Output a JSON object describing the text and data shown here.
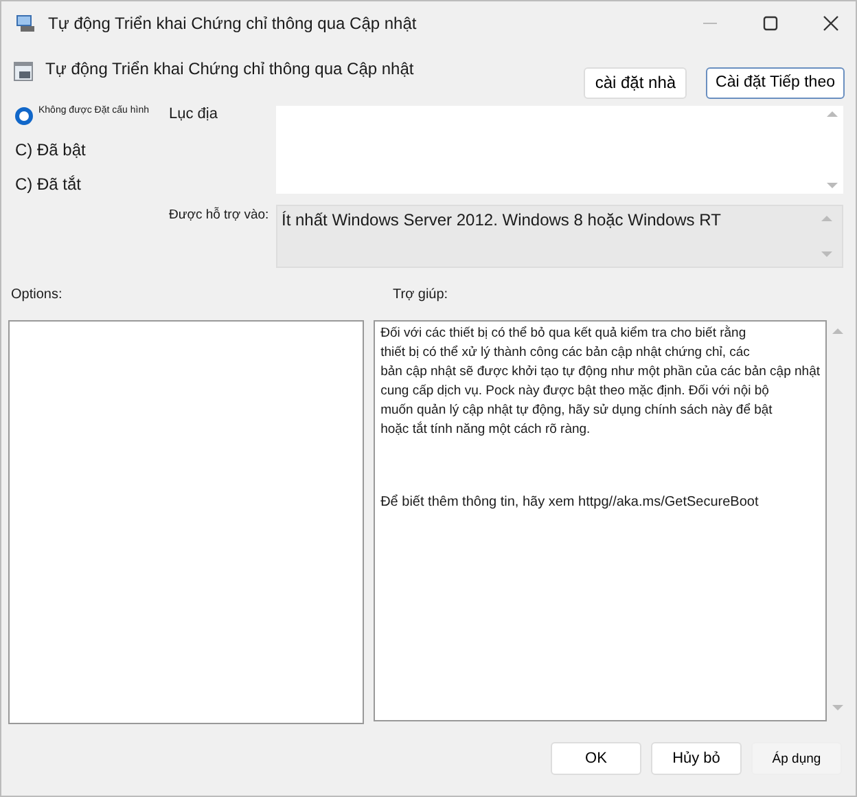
{
  "window": {
    "title": "Tự động Triển khai Chứng chỉ thông qua Cập nhật"
  },
  "header": {
    "title": "Tự động Triển khai Chứng chỉ thông qua Cập nhật",
    "buttons": [
      "cài đặt nhà",
      "Cài đặt Tiếp theo"
    ]
  },
  "options": [
    {
      "label": "Không được Đặt cấu hình",
      "selected": true
    },
    {
      "label": "C) Đã bật",
      "selected": false
    },
    {
      "label": "C) Đã tắt",
      "selected": false
    }
  ],
  "comment": {
    "label": "Lục địa"
  },
  "supported": {
    "label": "Được hỗ trợ vào:",
    "value": "Ít nhất Windows Server 2012. Windows 8 hoặc Windows RT"
  },
  "options_label": "Options:",
  "help": {
    "label": "Trợ giúp:",
    "lines": [
      "Đối với các thiết bị có thể bỏ qua kết quả kiểm tra cho biết rằng",
      "thiết bị có thể xử lý thành công các bản cập nhật chứng chỉ, các",
      "bản cập nhật sẽ được khởi tạo tự động như một phần của các bản cập nhật",
      "cung cấp dịch vụ. Pock này được bật theo mặc định. Đối với nội bộ",
      "muốn quản lý cập nhật tự động, hãy sử dụng chính sách này để bật",
      "hoặc tắt tính năng một cách rõ ràng."
    ],
    "footer": "Để biết thêm thông tin, hãy xem httpg//aka.ms/GetSecureBoot"
  },
  "buttons": [
    "OK",
    "Hủy bỏ",
    "Áp dụng"
  ]
}
